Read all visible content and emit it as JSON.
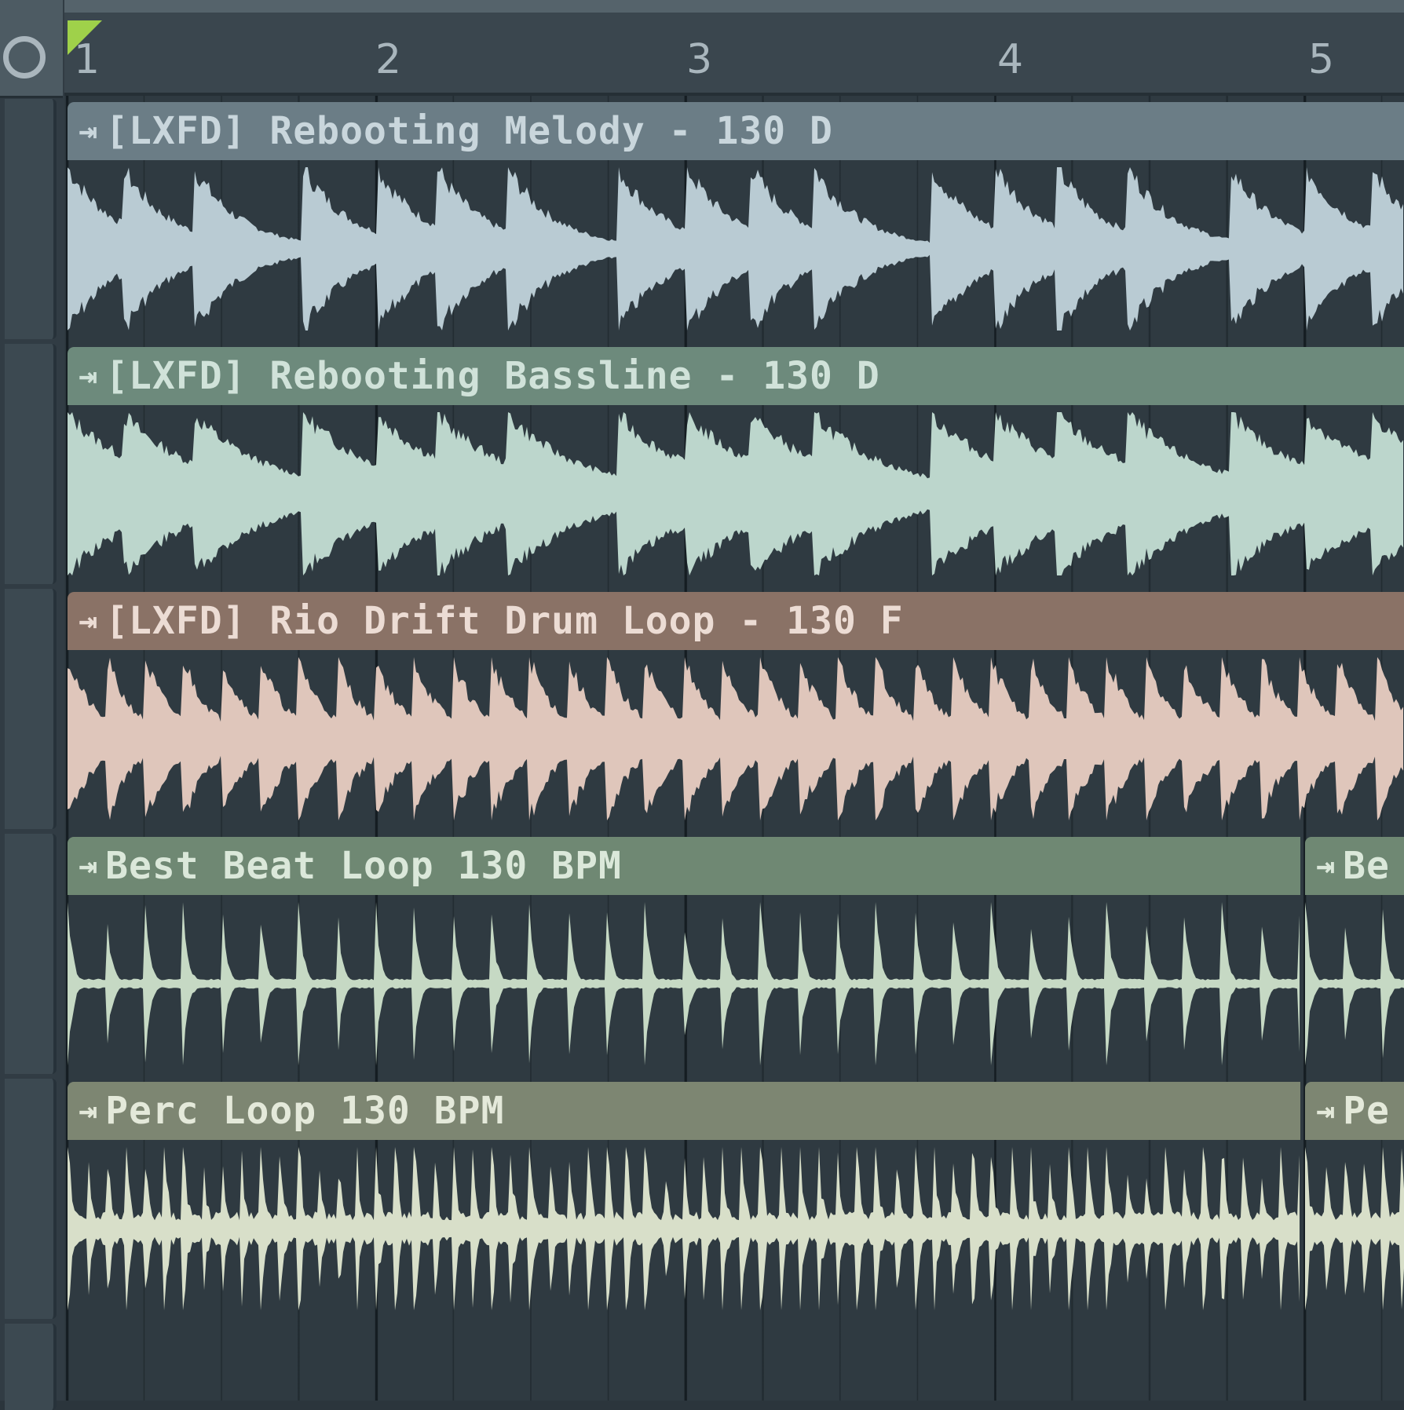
{
  "ruler": {
    "bar_numbers": [
      "1",
      "2",
      "3",
      "4",
      "5"
    ]
  },
  "colors": {
    "melody": "#6b7d86",
    "melody_wave": "#b9cbd3",
    "bassline": "#6d8a7c",
    "bassline_wave": "#bcd6cc",
    "drums": "#8a7266",
    "drums_wave": "#dfc6bb",
    "beat": "#6f8873",
    "beat_wave": "#c6d9c4",
    "perc": "#7d8672",
    "perc_wave": "#d8dfc9",
    "playhead": "#9fd14a"
  },
  "clips": [
    {
      "name": "[LXFD] Rebooting Melody - 130 D",
      "icon": "clip-arrow-icon"
    },
    {
      "name": "[LXFD] Rebooting Bassline - 130 D",
      "icon": "clip-arrow-icon"
    },
    {
      "name": "[LXFD] Rio Drift Drum Loop - 130 F",
      "icon": "clip-arrow-icon"
    },
    {
      "name": "Best Beat Loop 130 BPM",
      "icon": "clip-arrow-icon",
      "next_name": "Be"
    },
    {
      "name": "Perc Loop 130 BPM",
      "icon": "clip-arrow-icon",
      "next_name": "Pe"
    }
  ],
  "arrow_glyph": "⇥"
}
